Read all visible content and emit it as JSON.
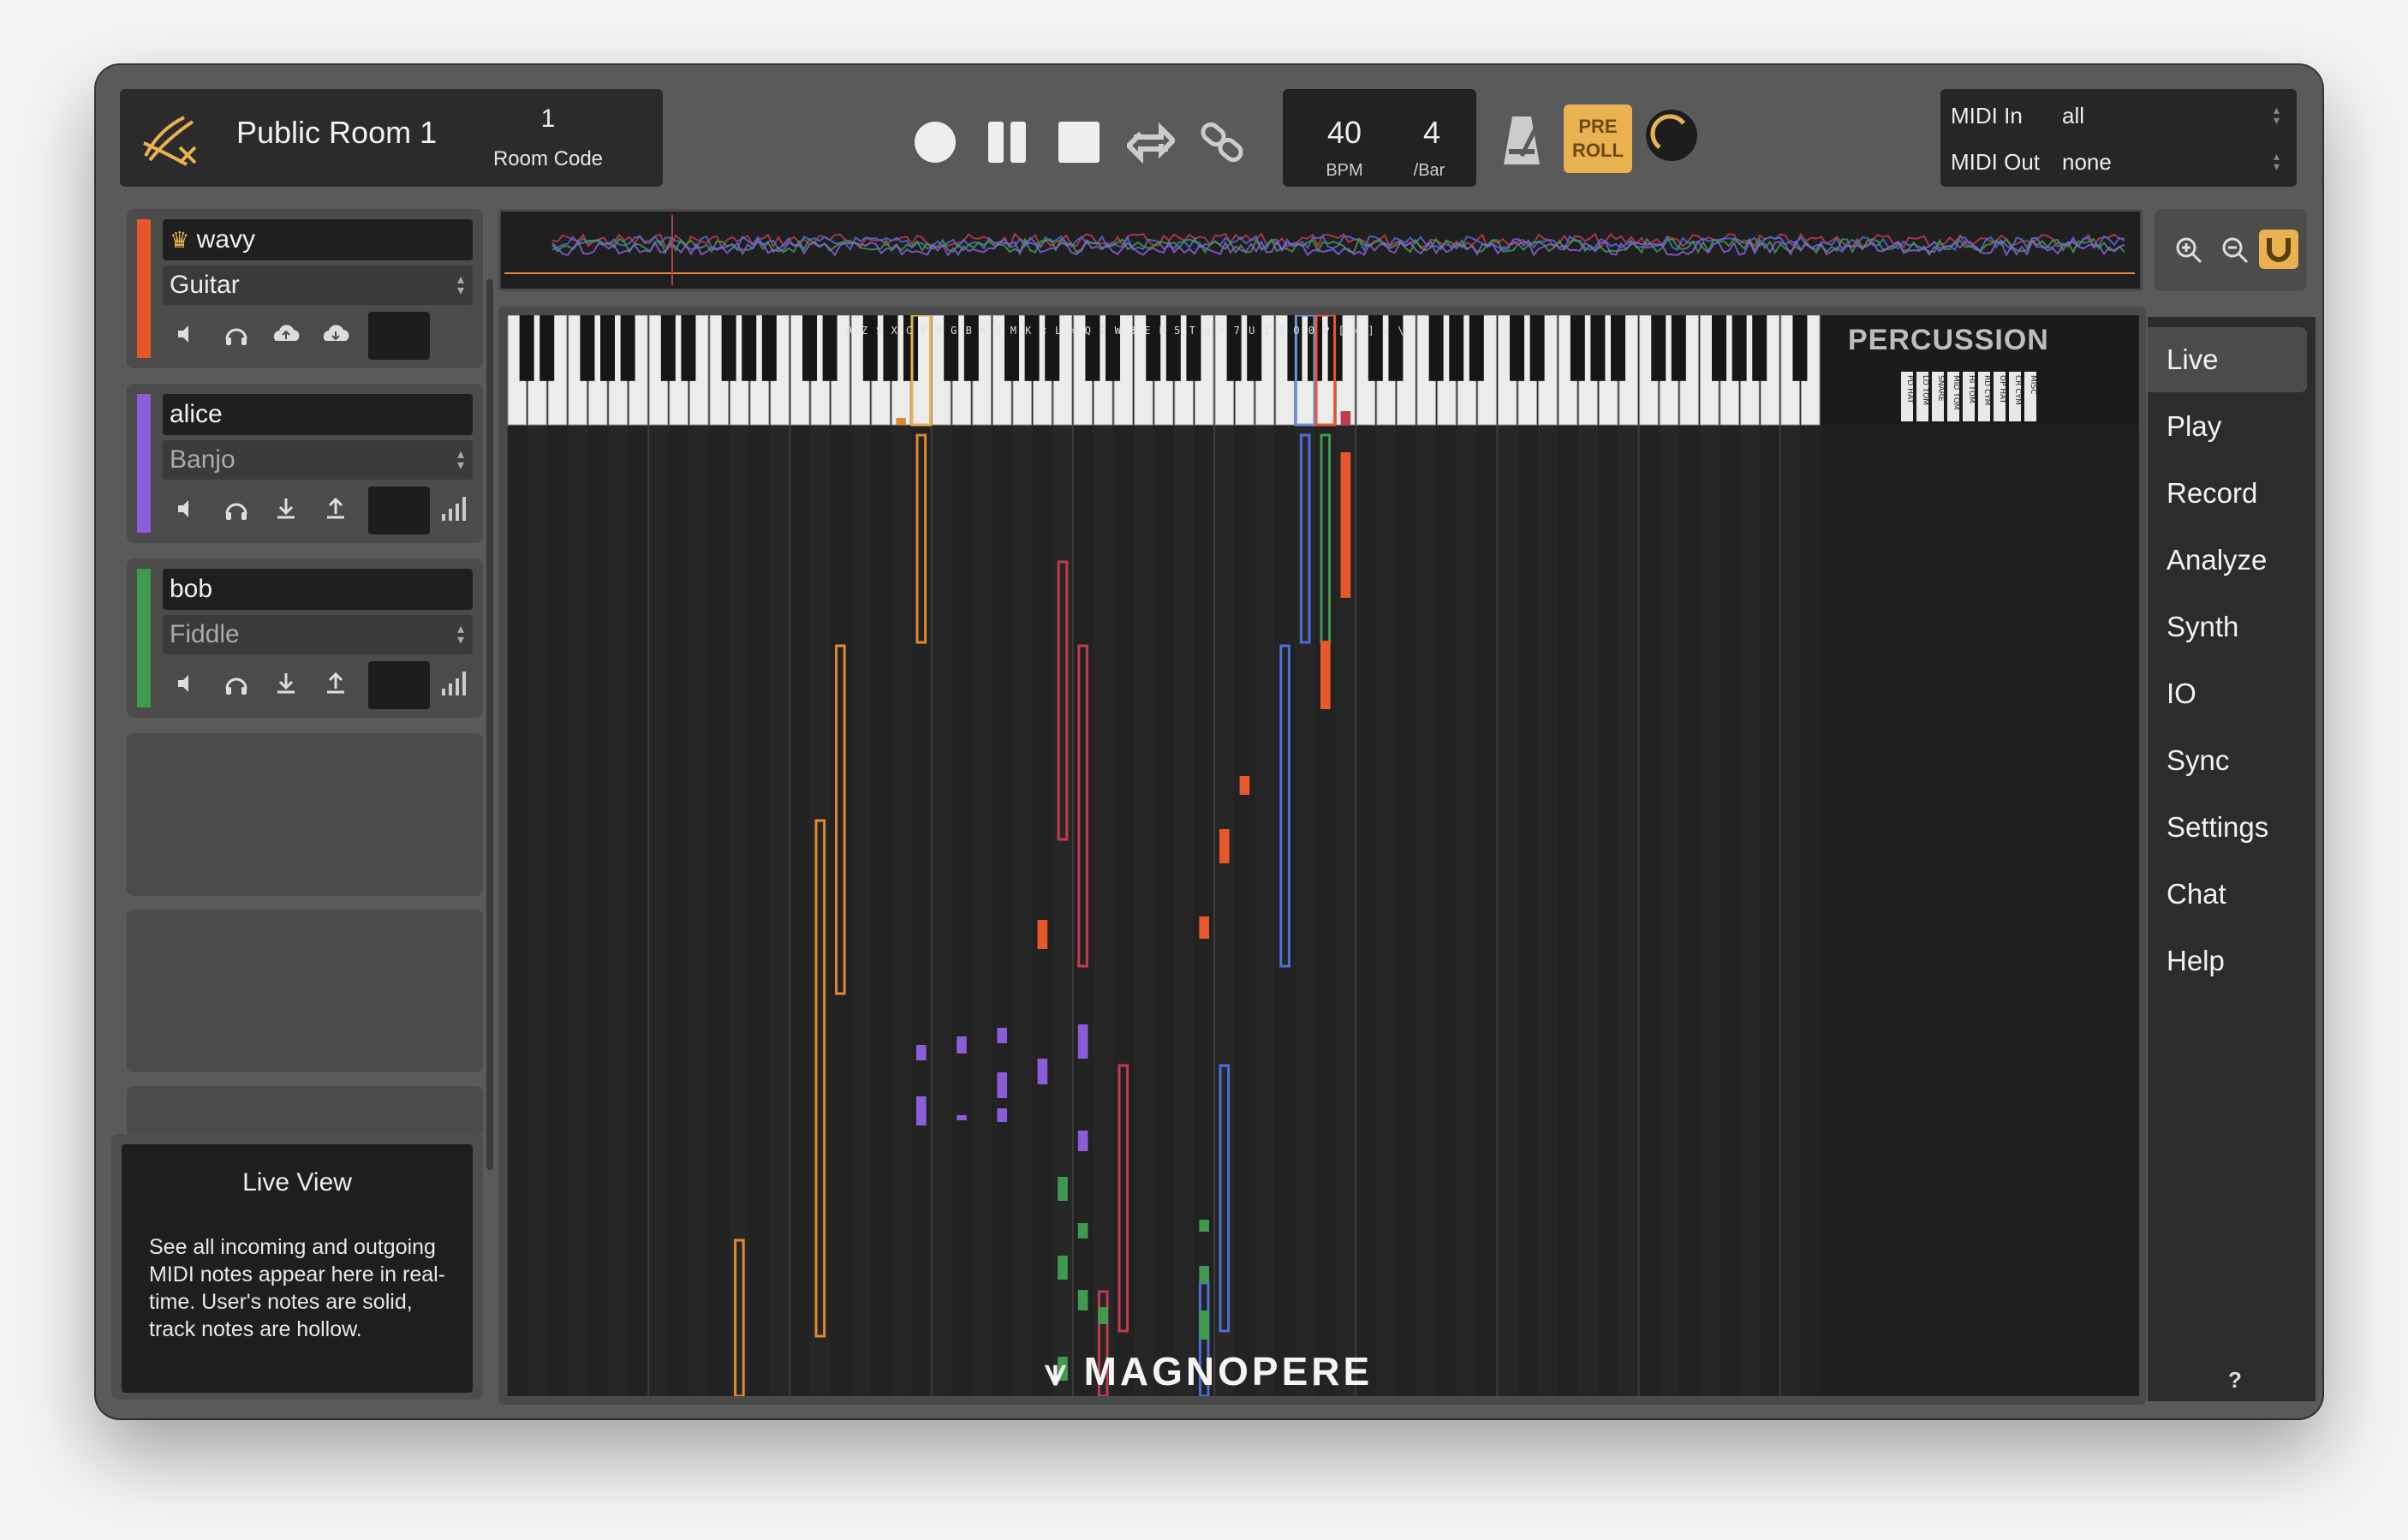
{
  "header": {
    "room_name": "Public Room 1",
    "room_number": "1",
    "room_code_label": "Room Code"
  },
  "transport": {
    "record_icon": "record-icon",
    "pause_icon": "pause-icon",
    "stop_icon": "stop-icon",
    "loop_icon": "loop-icon",
    "link_icon": "link-icon"
  },
  "tempo": {
    "bpm": "40",
    "bpm_label": "BPM",
    "beats": "4",
    "beats_label": "/Bar"
  },
  "preroll": {
    "line1": "PRE",
    "line2": "ROLL"
  },
  "midi": {
    "in_label": "MIDI In",
    "in_value": "all",
    "out_label": "MIDI Out",
    "out_value": "none"
  },
  "tracks": [
    {
      "name": "wavy",
      "instrument": "Guitar",
      "color": "#e8572a",
      "owner": true
    },
    {
      "name": "alice",
      "instrument": "Banjo",
      "color": "#8a5ed8",
      "owner": false
    },
    {
      "name": "bob",
      "instrument": "Fiddle",
      "color": "#3f9a4f",
      "owner": false
    }
  ],
  "info": {
    "title": "Live View",
    "body": "See all incoming and outgoing MIDI notes appear here in real-time. User's notes are solid, track notes are hollow."
  },
  "percussion": {
    "title": "PERCUSSION",
    "labels": [
      "PD HAT",
      "LO TOM",
      "SNARE",
      "MID TOM",
      "HI TOM",
      "RD CYM",
      "OP HAT",
      "CR CYM",
      "MISC"
    ]
  },
  "keyboard_letters": [
    "A",
    "Z",
    "S",
    "X",
    "C",
    "F",
    "V",
    "G",
    "B",
    "N",
    "J",
    "M",
    "K",
    "<",
    "L",
    ">",
    "Q",
    "2",
    "W",
    "3",
    "E",
    "R",
    "5",
    "T",
    "6",
    "Y",
    "7",
    "U",
    "I",
    "9",
    "O",
    "0",
    "P",
    "[",
    "=",
    "]",
    "←",
    "\\"
  ],
  "nav": {
    "items": [
      "Live",
      "Play",
      "Record",
      "Analyze",
      "Synth",
      "IO",
      "Sync",
      "Settings",
      "Chat",
      "Help"
    ],
    "active": "Live",
    "help_hint": "?"
  },
  "brand": {
    "logo_text": "MAGNOPERE"
  },
  "colors": {
    "accent": "#e9b150",
    "orange": "#e8572a",
    "purple": "#8a5ed8",
    "green": "#3f9a4f",
    "red": "#c23a50",
    "blue": "#4b6fd6",
    "amber": "#e08a30"
  }
}
